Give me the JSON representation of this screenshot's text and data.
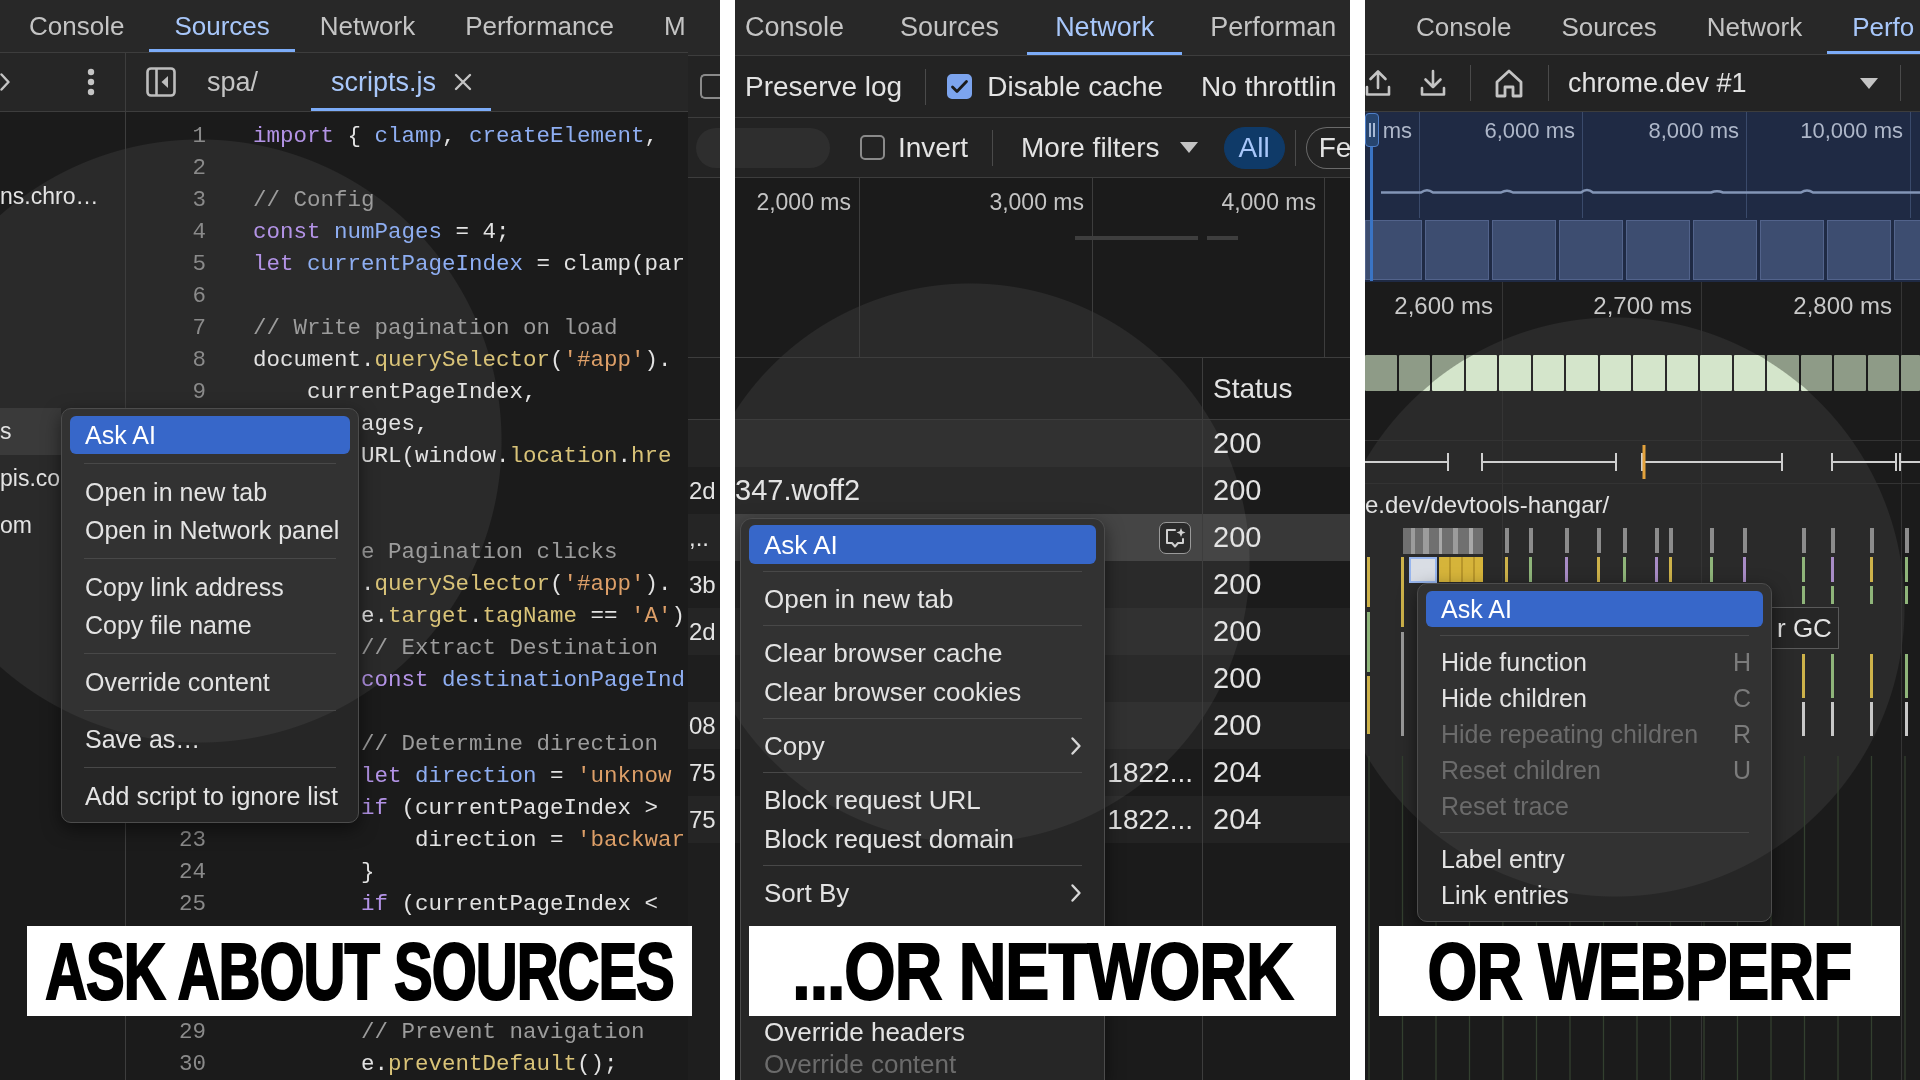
{
  "panels": [
    {
      "kind": "sources",
      "tabs": [
        {
          "label": "Console",
          "selected": false
        },
        {
          "label": "Sources",
          "selected": true
        },
        {
          "label": "Network",
          "selected": false
        },
        {
          "label": "Performance",
          "selected": false
        },
        {
          "label": "M",
          "selected": false
        }
      ],
      "navigator": [
        {
          "kind": "blank"
        },
        {
          "kind": "item",
          "text": "ns.chro…",
          "selected": false
        },
        {
          "kind": "blank"
        },
        {
          "kind": "blank"
        },
        {
          "kind": "blank"
        },
        {
          "kind": "blank"
        },
        {
          "kind": "item",
          "text": "s",
          "selected": true
        },
        {
          "kind": "item",
          "text": "pis.co",
          "selected": false
        },
        {
          "kind": "item",
          "text": "om",
          "selected": false
        }
      ],
      "editor_tabs": [
        {
          "label": "spa/",
          "selected": false
        },
        {
          "label": "scripts.js",
          "selected": true
        }
      ],
      "code_lines": [
        {
          "kind": "code",
          "number": "1",
          "tokens": [
            {
              "kind": "keyword",
              "text": "import"
            },
            {
              "kind": "plain",
              "text": " { "
            },
            {
              "kind": "name",
              "text": "clamp"
            },
            {
              "kind": "plain",
              "text": ", "
            },
            {
              "kind": "name",
              "text": "createElement"
            },
            {
              "kind": "plain",
              "text": ","
            }
          ]
        },
        {
          "kind": "code",
          "number": "2"
        },
        {
          "kind": "code",
          "number": "3",
          "tokens": [
            {
              "kind": "comment",
              "text": "// Config"
            }
          ]
        },
        {
          "kind": "code",
          "number": "4",
          "tokens": [
            {
              "kind": "keyword",
              "text": "const "
            },
            {
              "kind": "name",
              "text": "numPages"
            },
            {
              "kind": "plain",
              "text": " = 4;"
            }
          ]
        },
        {
          "kind": "code",
          "number": "5",
          "tokens": [
            {
              "kind": "keyword",
              "text": "let "
            },
            {
              "kind": "name",
              "text": "currentPageIndex"
            },
            {
              "kind": "plain",
              "text": " = clamp(par"
            }
          ]
        },
        {
          "kind": "code",
          "number": "6"
        },
        {
          "kind": "code",
          "number": "7",
          "tokens": [
            {
              "kind": "comment",
              "text": "// Write pagination on load"
            }
          ]
        },
        {
          "kind": "code",
          "number": "8",
          "tokens": [
            {
              "kind": "plain",
              "text": "document."
            },
            {
              "kind": "property",
              "text": "querySelector"
            },
            {
              "kind": "plain",
              "text": "("
            },
            {
              "kind": "string",
              "text": "'#app'"
            },
            {
              "kind": "plain",
              "text": ")."
            }
          ]
        },
        {
          "kind": "code",
          "number": "9",
          "tokens": [
            {
              "kind": "plain",
              "text": "    currentPageIndex,"
            }
          ]
        },
        {
          "kind": "code",
          "tokens": [
            {
              "kind": "plain",
              "text": "        ages,"
            }
          ]
        },
        {
          "kind": "code",
          "tokens": [
            {
              "kind": "plain",
              "text": "        URL(window."
            },
            {
              "kind": "property",
              "text": "location"
            },
            {
              "kind": "plain",
              "text": "."
            },
            {
              "kind": "property",
              "text": "hre"
            }
          ]
        },
        {
          "kind": "hidden"
        },
        {
          "kind": "hidden"
        },
        {
          "kind": "code",
          "tokens": [
            {
              "kind": "comment",
              "text": "        e Pagination clicks"
            }
          ]
        },
        {
          "kind": "code",
          "tokens": [
            {
              "kind": "plain",
              "text": "        ."
            },
            {
              "kind": "property",
              "text": "querySelector"
            },
            {
              "kind": "plain",
              "text": "("
            },
            {
              "kind": "string",
              "text": "'#app'"
            },
            {
              "kind": "plain",
              "text": ")."
            }
          ]
        },
        {
          "kind": "code",
          "tokens": [
            {
              "kind": "plain",
              "text": "        e."
            },
            {
              "kind": "property",
              "text": "target"
            },
            {
              "kind": "plain",
              "text": "."
            },
            {
              "kind": "property",
              "text": "tagName"
            },
            {
              "kind": "plain",
              "text": " == "
            },
            {
              "kind": "string",
              "text": "'A'"
            },
            {
              "kind": "plain",
              "text": ")"
            }
          ]
        },
        {
          "kind": "code",
          "tokens": [
            {
              "kind": "comment",
              "text": "        // Extract Destination"
            }
          ]
        },
        {
          "kind": "code",
          "tokens": [
            {
              "kind": "keyword",
              "text": "        const "
            },
            {
              "kind": "name",
              "text": "destinationPageInd"
            }
          ]
        },
        {
          "kind": "hidden"
        },
        {
          "kind": "code",
          "tokens": [
            {
              "kind": "comment",
              "text": "        // Determine direction"
            }
          ]
        },
        {
          "kind": "code",
          "tokens": [
            {
              "kind": "keyword",
              "text": "        let "
            },
            {
              "kind": "name",
              "text": "direction"
            },
            {
              "kind": "plain",
              "text": " = "
            },
            {
              "kind": "string",
              "text": "'unknow"
            }
          ]
        },
        {
          "kind": "code",
          "tokens": [
            {
              "kind": "keyword",
              "text": "        if"
            },
            {
              "kind": "plain",
              "text": " (currentPageIndex >"
            }
          ]
        },
        {
          "kind": "code",
          "number": "23",
          "tokens": [
            {
              "kind": "plain",
              "text": "            direction = "
            },
            {
              "kind": "string",
              "text": "'backwar"
            }
          ]
        },
        {
          "kind": "code",
          "number": "24",
          "tokens": [
            {
              "kind": "plain",
              "text": "        }"
            }
          ]
        },
        {
          "kind": "code",
          "number": "25",
          "tokens": [
            {
              "kind": "keyword",
              "text": "        if"
            },
            {
              "kind": "plain",
              "text": " (currentPageIndex <"
            }
          ]
        },
        {
          "kind": "hidden"
        },
        {
          "kind": "hidden"
        },
        {
          "kind": "hidden"
        },
        {
          "kind": "code",
          "number": "29",
          "tokens": [
            {
              "kind": "comment",
              "text": "        // Prevent navigation"
            }
          ]
        },
        {
          "kind": "code",
          "number": "30",
          "tokens": [
            {
              "kind": "plain",
              "text": "        e."
            },
            {
              "kind": "property",
              "text": "preventDefault"
            },
            {
              "kind": "plain",
              "text": "();"
            }
          ]
        }
      ],
      "side_strip": {
        "checkbox": {
          "checked": false
        },
        "rows": [
          {
            "kind": "blank"
          },
          {
            "kind": "text",
            "text": "2d"
          },
          {
            "kind": "text",
            "text": ",.."
          },
          {
            "kind": "text",
            "text": "3b"
          },
          {
            "kind": "text",
            "text": "2d"
          },
          {
            "kind": "blank"
          },
          {
            "kind": "text",
            "text": "08"
          },
          {
            "kind": "text",
            "text": "75"
          },
          {
            "kind": "text",
            "text": "75"
          }
        ]
      },
      "context_menu": {
        "groups": [
          [
            {
              "label": "Ask AI",
              "selected": true
            }
          ],
          [
            {
              "label": "Open in new tab",
              "selected": false
            },
            {
              "label": "Open in Network panel",
              "selected": false
            }
          ],
          [
            {
              "label": "Copy link address",
              "selected": false
            },
            {
              "label": "Copy file name",
              "selected": false
            }
          ],
          [
            {
              "label": "Override content",
              "selected": false
            }
          ],
          [
            {
              "label": "Save as…",
              "selected": false
            }
          ],
          [
            {
              "label": "Add script to ignore list",
              "selected": false
            }
          ]
        ]
      },
      "caption": "ASK ABOUT SOURCES"
    },
    {
      "kind": "network",
      "tabs": [
        {
          "label": "Console",
          "selected": false
        },
        {
          "label": "Sources",
          "selected": false
        },
        {
          "label": "Network",
          "selected": true
        },
        {
          "label": "Performan",
          "selected": false
        }
      ],
      "toolbar": {
        "preserve_log": "Preserve log",
        "disable_cache": {
          "label": "Disable cache",
          "checked": true
        },
        "throttling": "No throttlin"
      },
      "filter_bar": {
        "invert": {
          "label": "Invert",
          "checked": false
        },
        "more_filters": "More filters",
        "type_filters": [
          {
            "label": "All",
            "selected": true
          },
          {
            "label": "Fe",
            "selected": false
          }
        ]
      },
      "overview": {
        "ticks": [
          "2,000 ms",
          "3,000 ms",
          "4,000 ms"
        ]
      },
      "table": {
        "header": "Status",
        "rows": [
          {
            "status": "200",
            "hovered": false
          },
          {
            "column_1": {
              "kind": "clipped",
              "text": "347.woff2"
            },
            "status": "200",
            "hovered": false
          },
          {
            "status": "200",
            "hovered": true
          },
          {
            "status": "200",
            "hovered": false
          },
          {
            "status": "200",
            "hovered": false
          },
          {
            "status": "200",
            "hovered": false
          },
          {
            "status": "200",
            "hovered": false
          },
          {
            "column_1": {
              "kind": "ellipsized",
              "text": "1822..."
            },
            "status": "204",
            "hovered": false
          },
          {
            "column_1": {
              "kind": "ellipsized",
              "text": "1822..."
            },
            "status": "204",
            "hovered": false
          }
        ]
      },
      "context_menu": {
        "groups": [
          [
            {
              "label": "Ask AI",
              "selected": true,
              "submenu": false,
              "disabled": false
            }
          ],
          [
            {
              "label": "Open in new tab",
              "selected": false,
              "submenu": false,
              "disabled": false
            }
          ],
          [
            {
              "label": "Clear browser cache",
              "selected": false,
              "submenu": false,
              "disabled": false
            },
            {
              "label": "Clear browser cookies",
              "selected": false,
              "submenu": false,
              "disabled": false
            }
          ],
          [
            {
              "label": "Copy",
              "selected": false,
              "submenu": true,
              "disabled": false
            }
          ],
          [
            {
              "label": "Block request URL",
              "selected": false,
              "submenu": false,
              "disabled": false
            },
            {
              "label": "Block request domain",
              "selected": false,
              "submenu": false,
              "disabled": false
            }
          ],
          [
            {
              "label": "Sort By",
              "selected": false,
              "submenu": true,
              "disabled": false
            }
          ]
        ],
        "items_below_caption": [
          {
            "label": "Override headers",
            "selected": false,
            "submenu": false,
            "disabled": false
          },
          {
            "label": "Override content",
            "selected": false,
            "submenu": false,
            "disabled": true
          }
        ]
      },
      "caption": "...OR NETWORK"
    },
    {
      "kind": "performance",
      "tabs": [
        {
          "label": "Console",
          "selected": false
        },
        {
          "label": "Sources",
          "selected": false
        },
        {
          "label": "Network",
          "selected": false
        },
        {
          "label": "Perfo",
          "selected": true
        }
      ],
      "toolbar": {
        "recording": "chrome.dev #1"
      },
      "overview": {
        "ticks": [
          "ms",
          "6,000 ms",
          "8,000 ms",
          "10,000 ms"
        ]
      },
      "ruler": {
        "ticks": [
          "2,600 ms",
          "2,700 ms",
          "2,800 ms"
        ]
      },
      "track_title": "e.dev/devtools-hangar/",
      "entry_label": "r GC",
      "context_menu": {
        "groups": [
          [
            {
              "label": "Ask AI",
              "selected": true,
              "disabled": false
            }
          ],
          [
            {
              "label": "Hide function",
              "shortcut": "H",
              "selected": false,
              "disabled": false
            },
            {
              "label": "Hide children",
              "shortcut": "C",
              "selected": false,
              "disabled": false
            },
            {
              "label": "Hide repeating children",
              "shortcut": "R",
              "selected": false,
              "disabled": true
            },
            {
              "label": "Reset children",
              "shortcut": "U",
              "selected": false,
              "disabled": true
            },
            {
              "label": "Reset trace",
              "selected": false,
              "disabled": true
            }
          ],
          [
            {
              "label": "Label entry",
              "selected": false,
              "disabled": false
            },
            {
              "label": "Link entries",
              "selected": false,
              "disabled": false
            }
          ]
        ]
      },
      "caption": "OR WEBPERF"
    }
  ]
}
